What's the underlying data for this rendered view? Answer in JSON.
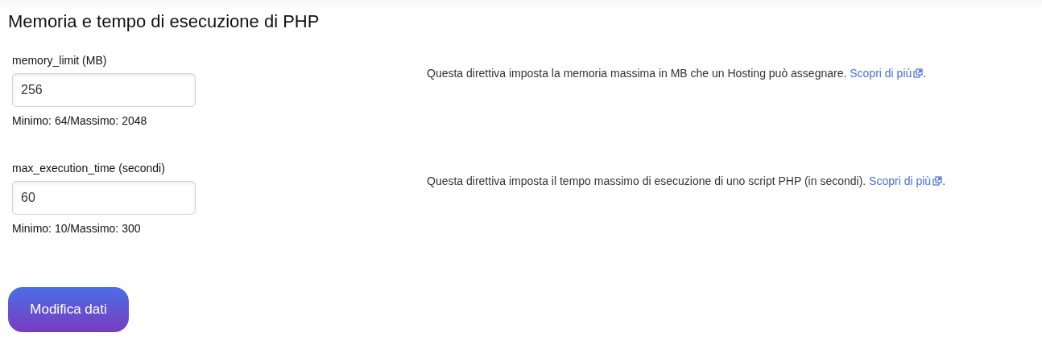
{
  "title": "Memoria e tempo di esecuzione di PHP",
  "settings": [
    {
      "label": "memory_limit (MB)",
      "value": "256",
      "hint": "Minimo: 64/Massimo: 2048",
      "description": "Questa direttiva imposta la memoria massima in MB che un Hosting può assegnare. ",
      "link": "Scopri di più",
      "after": "."
    },
    {
      "label": "max_execution_time (secondi)",
      "value": "60",
      "hint": "Minimo: 10/Massimo: 300",
      "description": "Questa direttiva imposta il tempo massimo di esecuzione di uno script PHP (in secondi). ",
      "link": "Scopri di più",
      "after": "."
    }
  ],
  "submit": "Modifica dati"
}
